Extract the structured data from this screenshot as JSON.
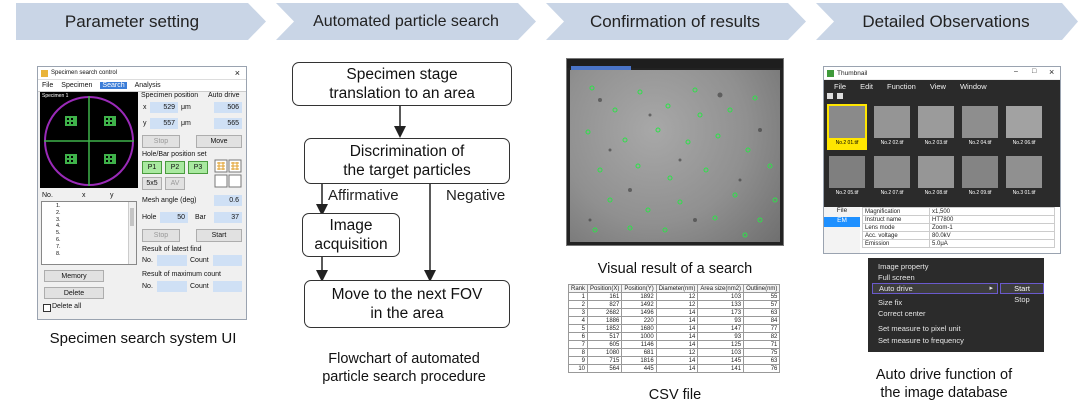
{
  "steps": [
    {
      "label": "Parameter setting"
    },
    {
      "label": "Automated particle search"
    },
    {
      "label": "Confirmation of results"
    },
    {
      "label": "Detailed Observations"
    }
  ],
  "panel1": {
    "caption": "Specimen search system UI",
    "window": {
      "title": "Specimen search control",
      "close": "×",
      "menu": [
        "File",
        "Specimen",
        "Search",
        "Analysis"
      ],
      "map_label": "Specimen 1",
      "specimen_position": "Specimen position",
      "auto_drive": "Auto drive",
      "x_label": "x",
      "x_value": "529",
      "x_unit": "μm",
      "x_auto": "506",
      "y_label": "y",
      "y_value": "557",
      "y_unit": "μm",
      "y_auto": "565",
      "stop": "Stop",
      "move": "Move",
      "hole_bar_position": "Hole/Bar position set",
      "p1": "P1",
      "p2": "P2",
      "p3": "P3",
      "five_by_five": "5x5",
      "av": "AV",
      "col_no": "No.",
      "col_x": "x",
      "col_y": "y",
      "list_items": [
        "1.",
        "2.",
        "3.",
        "4.",
        "5.",
        "6.",
        "7.",
        "8."
      ],
      "mesh_angle": "Mesh angle (deg)",
      "mesh_angle_value": "0.6",
      "hole": "Hole",
      "hole_value": "50",
      "bar": "Bar",
      "bar_value": "37",
      "stop2": "Stop",
      "start": "Start",
      "latest_find": "Result of latest find",
      "no": "No.",
      "count": "Count",
      "max_count": "Result of maximum count",
      "memory": "Memory",
      "delete": "Delete",
      "delete_all": "Delete all"
    }
  },
  "panel2": {
    "caption_line1": "Flowchart of automated",
    "caption_line2": "particle search procedure",
    "box1_line1": "Specimen stage",
    "box1_line2": "translation to an area",
    "box2_line1": "Discrimination of",
    "box2_line2": "the target particles",
    "affirmative": "Affirmative",
    "negative": "Negative",
    "box3_line1": "Image",
    "box3_line2": "acquisition",
    "box4_line1": "Move to the next FOV",
    "box4_line2": "in the area"
  },
  "panel3": {
    "caption_image": "Visual result of a search",
    "caption_csv": "CSV file",
    "csv_headers": [
      "Rank",
      "Position(X)",
      "Position(Y)",
      "Diameter(nm)",
      "Area size(nm2)",
      "Outline(nm)"
    ],
    "csv_rows": [
      [
        "1",
        "161",
        "1892",
        "12",
        "103",
        "55"
      ],
      [
        "2",
        "827",
        "1492",
        "12",
        "133",
        "57"
      ],
      [
        "3",
        "2682",
        "1496",
        "14",
        "173",
        "63"
      ],
      [
        "4",
        "1886",
        "220",
        "14",
        "93",
        "84"
      ],
      [
        "5",
        "1852",
        "1680",
        "14",
        "147",
        "77"
      ],
      [
        "6",
        "517",
        "1000",
        "14",
        "93",
        "82"
      ],
      [
        "7",
        "605",
        "1146",
        "14",
        "125",
        "71"
      ],
      [
        "8",
        "1080",
        "681",
        "12",
        "103",
        "75"
      ],
      [
        "9",
        "715",
        "1816",
        "14",
        "145",
        "63"
      ],
      [
        "10",
        "564",
        "445",
        "14",
        "141",
        "76"
      ]
    ]
  },
  "panel4": {
    "caption_line1": "Auto drive function of",
    "caption_line2": "the image database",
    "window": {
      "title": "Thumbnail",
      "controls": [
        "–",
        "□",
        "×"
      ],
      "menu": [
        "File",
        "Edit",
        "Function",
        "View",
        "Window"
      ],
      "thumbs_row1": [
        "No.2 01.tif",
        "No.2 02.tif",
        "No.2 03.tif",
        "No.2 04.tif",
        "No.2 06.tif"
      ],
      "thumbs_row2": [
        "No.2 05.tif",
        "No.2 07.tif",
        "No.2 08.tif",
        "No.2 09.tif",
        "No.3 01.tif"
      ],
      "side_tabs": [
        "File",
        "EM"
      ],
      "props": [
        [
          "Magnification",
          "x1,500"
        ],
        [
          "Instruct name",
          "HT7800"
        ],
        [
          "Lens mode",
          "Zoom-1"
        ],
        [
          "Acc. voltage",
          "80.0kV"
        ],
        [
          "Emission",
          "5.0μA"
        ]
      ]
    },
    "context_menu": {
      "items": [
        "Image property",
        "Full screen",
        "Auto drive",
        "Size fix",
        "Correct center",
        "Set measure to pixel unit",
        "Set measure to frequency"
      ],
      "arrow": "▸",
      "submenu": [
        "Start",
        "Stop"
      ]
    }
  }
}
